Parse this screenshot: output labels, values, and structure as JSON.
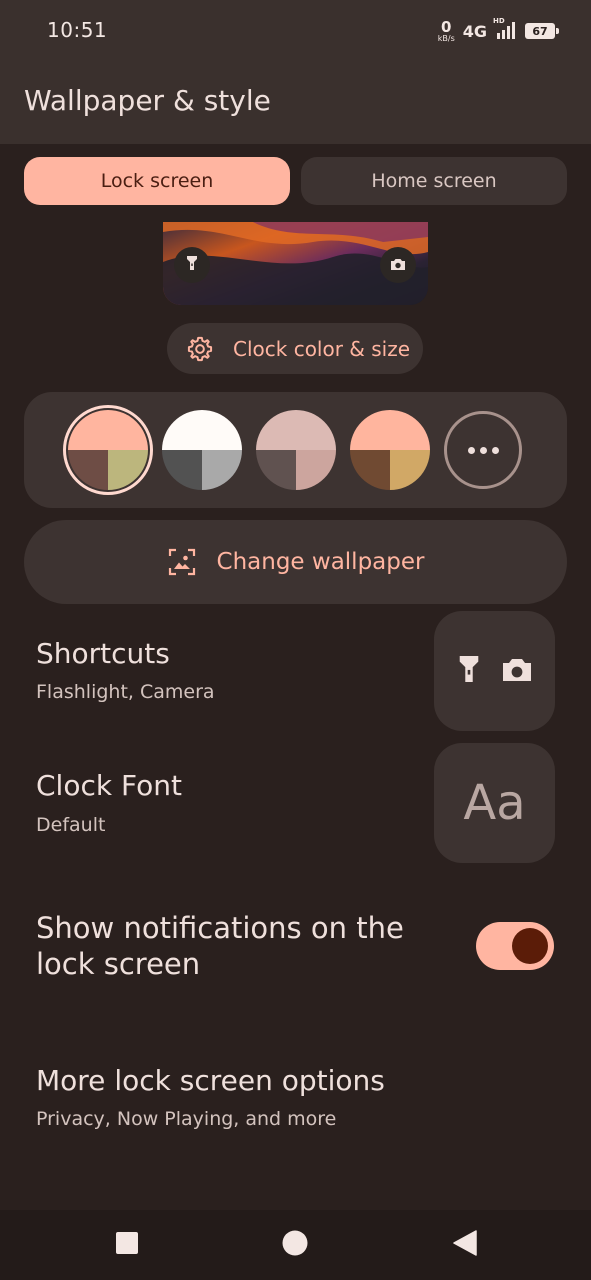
{
  "status_bar": {
    "time": "10:51",
    "net_speed_value": "0",
    "net_speed_unit": "kB/s",
    "network": "4G",
    "signal_badge": "HD",
    "battery": "67"
  },
  "app_bar": {
    "title": "Wallpaper & style"
  },
  "tabs": [
    {
      "label": "Lock screen",
      "selected": true
    },
    {
      "label": "Home screen",
      "selected": false
    }
  ],
  "preview": {
    "left_shortcut_icon": "flashlight-icon",
    "right_shortcut_icon": "camera-icon"
  },
  "clock_button": {
    "label": "Clock color & size",
    "icon": "gear-icon"
  },
  "palette": {
    "selected_index": 0,
    "swatches": [
      {
        "top": "#ffb59f",
        "bottom_left": "#6e4d45",
        "bottom_right": "#bcb67d"
      },
      {
        "top": "#fffbf8",
        "bottom_left": "#525252",
        "bottom_right": "#a9a9a9"
      },
      {
        "top": "#dcbab4",
        "bottom_left": "#605250",
        "bottom_right": "#cca59e"
      },
      {
        "top": "#ffb59e",
        "bottom_left": "#704a32",
        "bottom_right": "#d1a866"
      }
    ]
  },
  "change_wallpaper": {
    "label": "Change wallpaper",
    "icon": "image-icon"
  },
  "shortcuts": {
    "title": "Shortcuts",
    "subtitle": "Flashlight, Camera",
    "icons": [
      "flashlight-icon",
      "camera-icon"
    ]
  },
  "clock_font": {
    "title": "Clock Font",
    "subtitle": "Default",
    "preview_text": "Aa"
  },
  "notifications": {
    "title": "Show notifications on the lock screen",
    "enabled": true
  },
  "more_options": {
    "title": "More lock screen options",
    "subtitle": "Privacy, Now Playing, and more"
  },
  "colors": {
    "accent": "#ffb5a1",
    "background": "#2a201e",
    "surface": "#3d3331",
    "toggle_thumb": "#5b1c08"
  }
}
